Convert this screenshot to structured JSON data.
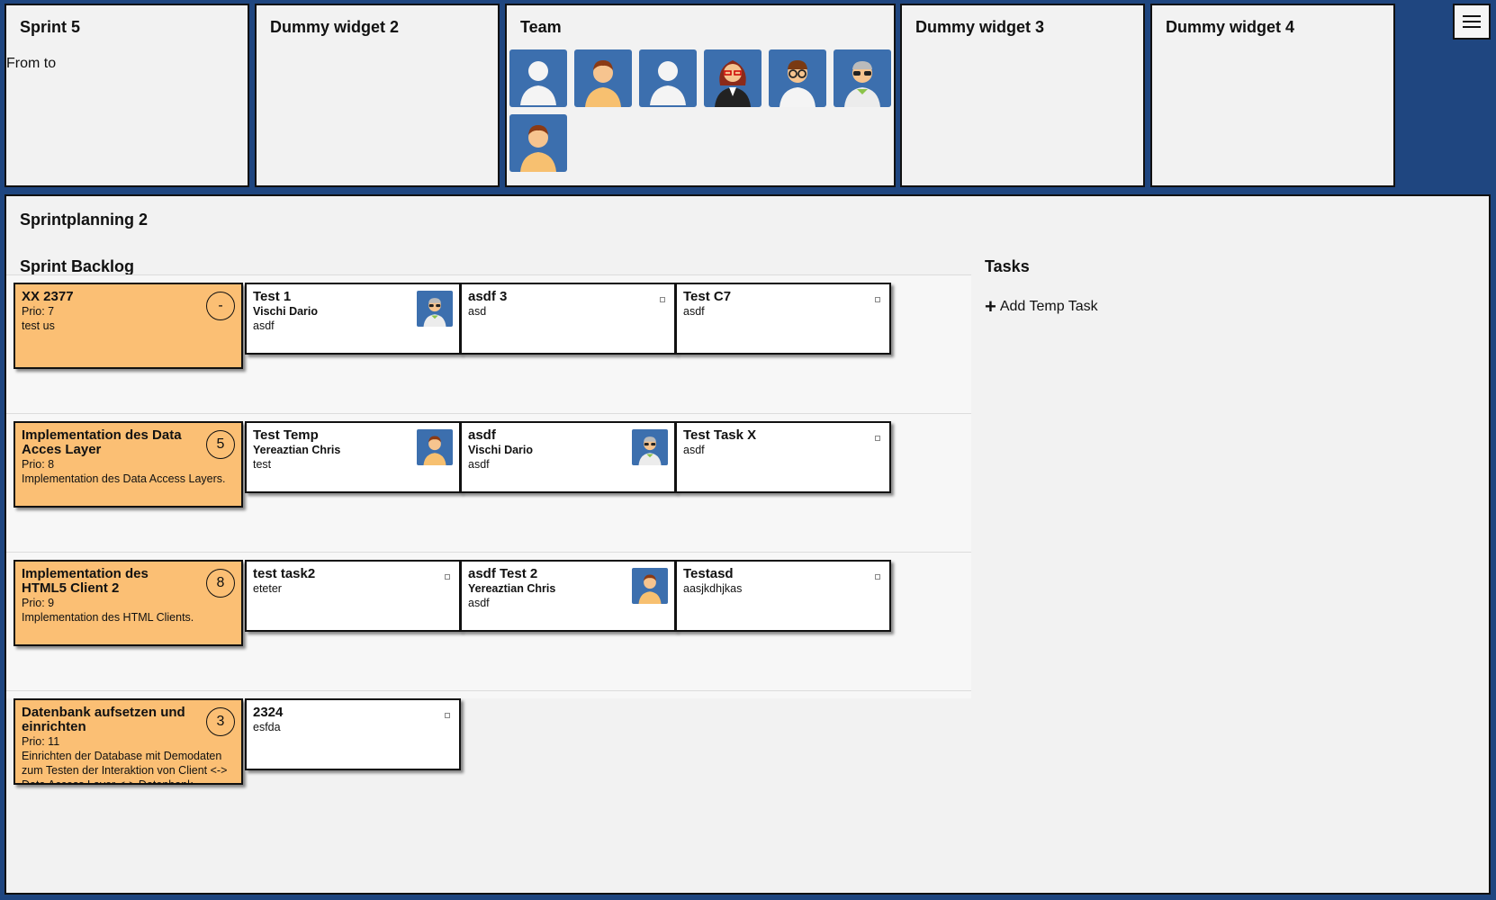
{
  "widgets": {
    "sprint": {
      "title": "Sprint 5",
      "from_to": "From to"
    },
    "dummy2": {
      "title": "Dummy widget 2"
    },
    "team": {
      "title": "Team",
      "members": [
        "silhouette",
        "man",
        "silhouette",
        "woman-glasses",
        "man-glasses",
        "man-sunglasses",
        "man"
      ]
    },
    "dummy3": {
      "title": "Dummy widget 3"
    },
    "dummy4": {
      "title": "Dummy widget 4"
    }
  },
  "menu": {
    "icon": "hamburger-menu-icon"
  },
  "board": {
    "title": "Sprintplanning 2",
    "backlog_title": "Sprint Backlog",
    "tasks_title": "Tasks",
    "add_task_label": "Add Temp Task",
    "rows": [
      {
        "story": {
          "title": "XX 2377",
          "points": "-",
          "prio": "Prio: 7",
          "desc": "test us"
        },
        "tasks": [
          {
            "title": "Test 1",
            "owner": "Vischi Dario",
            "desc": "asdf",
            "avatar": "man-sunglasses"
          },
          {
            "title": "asdf 3",
            "owner": "",
            "desc": "asd",
            "avatar": ""
          },
          {
            "title": "Test C7",
            "owner": "",
            "desc": "asdf",
            "avatar": ""
          }
        ]
      },
      {
        "story": {
          "title": "Implementation des Data Acces Layer",
          "points": "5",
          "prio": "Prio: 8",
          "desc": "Implementation des Data Access Layers."
        },
        "tasks": [
          {
            "title": "Test Temp",
            "owner": "Yereaztian Chris",
            "desc": "test",
            "avatar": "man"
          },
          {
            "title": "asdf",
            "owner": "Vischi Dario",
            "desc": "asdf",
            "avatar": "man-sunglasses"
          },
          {
            "title": "Test Task X",
            "owner": "",
            "desc": "asdf",
            "avatar": ""
          }
        ]
      },
      {
        "story": {
          "title": "Implementation des HTML5 Client 2",
          "points": "8",
          "prio": "Prio: 9",
          "desc": "Implementation des HTML Clients."
        },
        "tasks": [
          {
            "title": "test task2",
            "owner": "",
            "desc": "eteter",
            "avatar": ""
          },
          {
            "title": "asdf Test 2",
            "owner": "Yereaztian Chris",
            "desc": "asdf",
            "avatar": "man"
          },
          {
            "title": "Testasd",
            "owner": "",
            "desc": "aasjkdhjkas",
            "avatar": ""
          }
        ]
      },
      {
        "story": {
          "title": "Datenbank aufsetzen und einrichten",
          "points": "3",
          "prio": "Prio: 11",
          "desc": "Einrichten der Database mit Demodaten zum Testen der Interaktion von Client <-> Data Access Layer <-> Datenbank."
        },
        "tasks": [
          {
            "title": "2324",
            "owner": "",
            "desc": "esfda",
            "avatar": ""
          }
        ]
      }
    ]
  },
  "colors": {
    "background": "#1f4680",
    "story": "#fbbf74",
    "avatar_bg": "#3c6fae"
  }
}
